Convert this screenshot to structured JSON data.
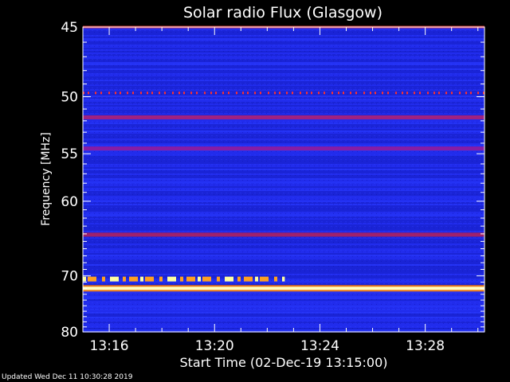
{
  "chart_data": {
    "type": "heatmap",
    "title": "Solar radio Flux (Glasgow)",
    "xlabel": "Start Time (02-Dec-19 13:15:00)",
    "ylabel": "Frequency [MHz]",
    "x_range": [
      "13:15:00",
      "13:30:15"
    ],
    "x_ticks": [
      "13:16",
      "13:20",
      "13:24",
      "13:28"
    ],
    "y_range": [
      45,
      80
    ],
    "y_ticks": [
      "45",
      "50",
      "55",
      "60",
      "70",
      "80"
    ],
    "y_scale": "reciprocal",
    "grid": false,
    "features": [
      {
        "frequency_mhz": 45.0,
        "start": "13:15:00",
        "end": "13:30:15",
        "intensity": "medium",
        "color": "#ff4040"
      },
      {
        "frequency_mhz": 49.7,
        "start": "13:15:00",
        "end": "13:30:15",
        "intensity": "medium-intermittent",
        "color": "#ff3030"
      },
      {
        "frequency_mhz": 51.7,
        "start": "13:15:00",
        "end": "13:30:15",
        "intensity": "low",
        "color": "#c0206a"
      },
      {
        "frequency_mhz": 54.5,
        "start": "13:15:00",
        "end": "13:30:15",
        "intensity": "low",
        "color": "#a01890"
      },
      {
        "frequency_mhz": 64.1,
        "start": "13:15:00",
        "end": "13:30:15",
        "intensity": "low",
        "color": "#c02050"
      },
      {
        "frequency_mhz": 70.5,
        "start": "13:15:00",
        "end": "13:22:40",
        "intensity": "high-intermittent",
        "color": "#ffa020"
      },
      {
        "frequency_mhz": 72.0,
        "start": "13:15:00",
        "end": "13:30:15",
        "intensity": "very-high",
        "color": "#ffffc0"
      }
    ],
    "colors": {
      "background": "#000000",
      "spectrogram_base": "#1e28e6",
      "text": "#ffffff"
    }
  },
  "footer": {
    "updated": "Updated Wed Dec 11 10:30:28 2019"
  }
}
